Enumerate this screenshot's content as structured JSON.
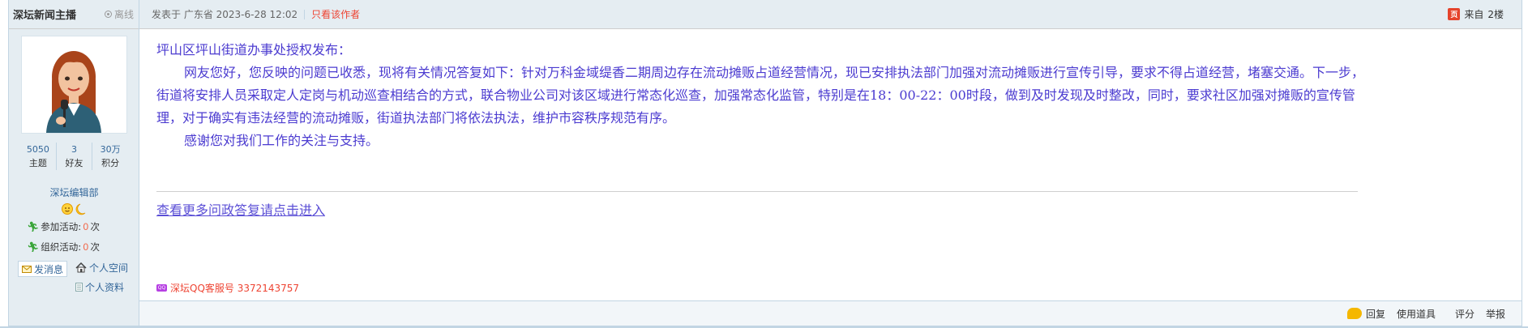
{
  "author": {
    "name": "深坛新闻主播",
    "status": "离线",
    "stats": [
      {
        "value": "5050",
        "label": "主题"
      },
      {
        "value": "3",
        "label": "好友"
      },
      {
        "value": "30万",
        "label": "积分"
      }
    ],
    "group": "深坛编辑部",
    "activities": [
      {
        "label": "参加活动:",
        "count": "0",
        "unit": "次"
      },
      {
        "label": "组织活动:",
        "count": "0",
        "unit": "次"
      }
    ],
    "send_message": "发消息",
    "personal_space": "个人空间",
    "personal_profile": "个人资料",
    "icons": {
      "status": "offline-icon",
      "activity": "runner-icon",
      "message": "envelope-icon",
      "space": "home-icon",
      "profile": "profile-card-icon"
    }
  },
  "post": {
    "meta": "发表于 广东省 2023-6-28 12:02",
    "author_only": "只看该作者",
    "floor_prefix": "来自",
    "floor": "2楼",
    "content": {
      "line1": "坪山区坪山街道办事处授权发布：",
      "paragraph": "网友您好，您反映的问题已收悉，现将有关情况答复如下：针对万科金域缇香二期周边存在流动摊贩占道经营情况，现已安排执法部门加强对流动摊贩进行宣传引导，要求不得占道经营，堵塞交通。下一步，街道将安排人员采取定人定岗与机动巡查相结合的方式，联合物业公司对该区域进行常态化巡查，加强常态化监管，特别是在18：00-22：00时段，做到及时发现及时整改，同时，要求社区加强对摊贩的宣传管理，对于确实有违法经营的流动摊贩，街道执法部门将依法执法，维护市容秩序规范有序。",
      "thanks": "感谢您对我们工作的关注与支持。"
    },
    "more_link": "查看更多问政答复请点击进入",
    "qq_text": "深坛QQ客服号 3372143757"
  },
  "footer": {
    "reply": "回复",
    "use_tool": "使用道具",
    "rate": "评分",
    "report": "举报"
  },
  "colors": {
    "content": "#4b3bd0",
    "link": "#369",
    "accent_red": "#e43",
    "border": "#c2d5e3"
  }
}
